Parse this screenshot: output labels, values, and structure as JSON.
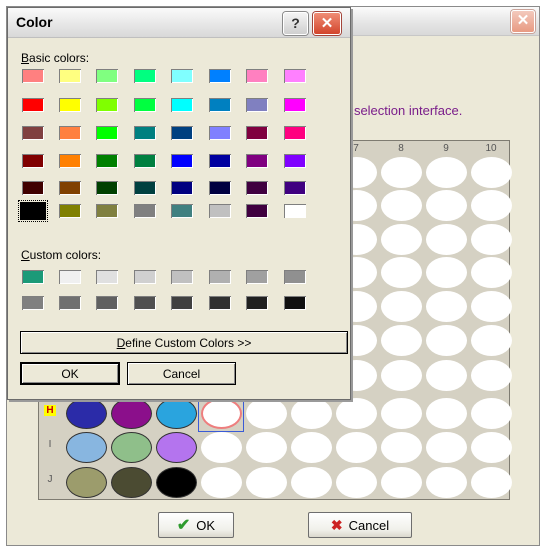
{
  "background_window": {
    "info_text": "r selection interface.",
    "close_label": "✕",
    "columns": [
      "7",
      "8",
      "9",
      "10"
    ],
    "rows": [
      "H",
      "I",
      "J"
    ],
    "ok_label": "OK",
    "cancel_label": "Cancel"
  },
  "dialog": {
    "title": "Color",
    "help_label": "?",
    "close_label": "✕",
    "basic_colors_prefix": "B",
    "basic_colors_rest": "asic colors:",
    "custom_colors_prefix": "C",
    "custom_colors_rest": "ustom colors:",
    "define_prefix": "D",
    "define_rest": "efine Custom Colors >>",
    "ok_label": "OK",
    "cancel_label": "Cancel",
    "selected_basic_color": "#000000"
  },
  "basic_colors": [
    [
      "#ff8080",
      "#ffff80",
      "#80ff80",
      "#00ff80",
      "#80ffff",
      "#0080ff",
      "#ff80c0",
      "#ff80ff"
    ],
    [
      "#ff0000",
      "#ffff00",
      "#80ff00",
      "#00ff40",
      "#00ffff",
      "#0080c0",
      "#8080c0",
      "#ff00ff"
    ],
    [
      "#804040",
      "#ff8040",
      "#00ff00",
      "#008080",
      "#004080",
      "#8080ff",
      "#800040",
      "#ff0080"
    ],
    [
      "#800000",
      "#ff8000",
      "#008000",
      "#008040",
      "#0000ff",
      "#0000a0",
      "#800080",
      "#8000ff"
    ],
    [
      "#400000",
      "#804000",
      "#004000",
      "#004040",
      "#000080",
      "#000040",
      "#400040",
      "#400080"
    ],
    [
      "#000000",
      "#808000",
      "#808040",
      "#808080",
      "#408080",
      "#c0c0c0",
      "#400040",
      "#ffffff"
    ]
  ],
  "custom_colors": [
    [
      "#1b9a78",
      "#f0f0f0",
      "#e0e0e0",
      "#d0d0d0",
      "#c0c0c0",
      "#b0b0b0",
      "#a0a0a0",
      "#909090"
    ],
    [
      "#808080",
      "#707070",
      "#606060",
      "#505050",
      "#404040",
      "#303030",
      "#202020",
      "#101010"
    ]
  ],
  "well_colors": {
    "H": [
      "#2b2ba8",
      "#8b0f8b",
      "#2aa4de"
    ],
    "I": [
      "#88b6e0",
      "#8fbf8a",
      "#b474ee"
    ],
    "J": [
      "#9c9c6c",
      "#4b4b32",
      "#000000"
    ]
  }
}
